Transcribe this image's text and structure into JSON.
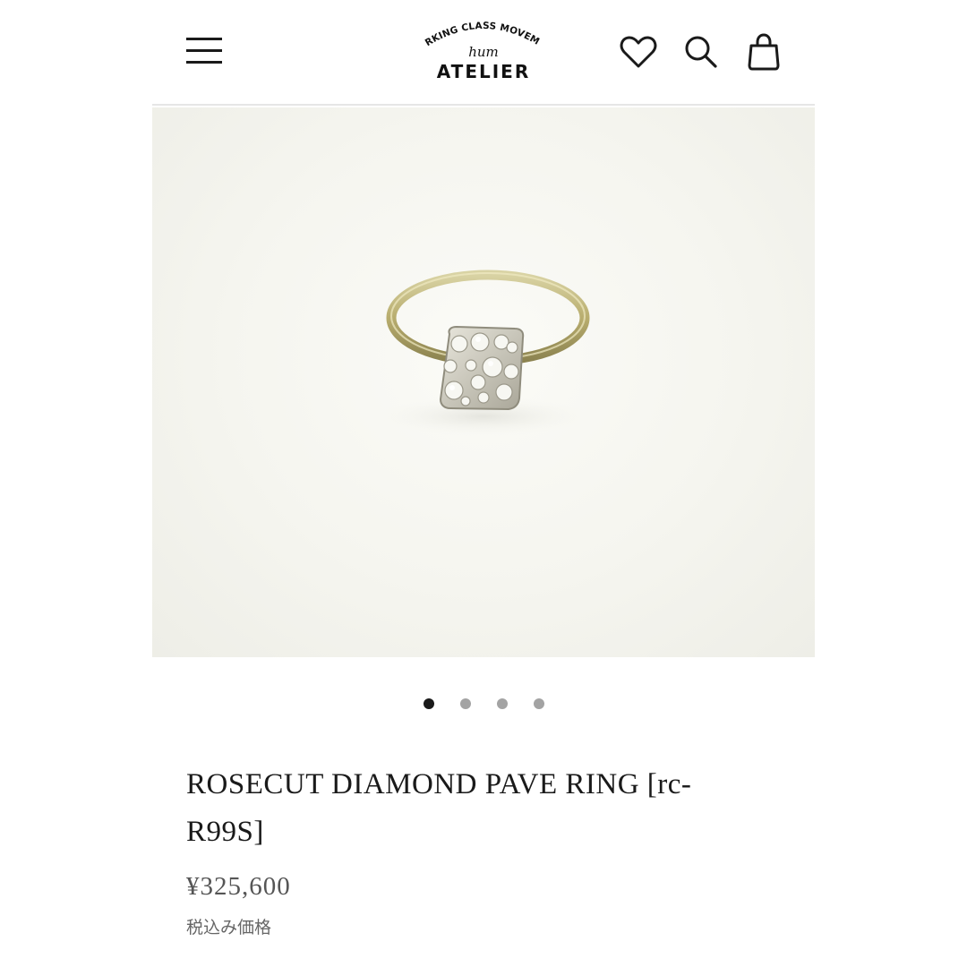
{
  "header": {
    "menu_icon": "hamburger-menu-icon",
    "logo": {
      "arc_text": "WORKING CLASS MOVEMENT",
      "script_text": "hum",
      "main_text": "ATELIER"
    },
    "icons": [
      "heart-icon",
      "search-icon",
      "shopping-bag-icon"
    ]
  },
  "gallery": {
    "slide_count": 4,
    "active_slide": 1,
    "image_subject": "ring-photo"
  },
  "product": {
    "title": "ROSECUT DIAMOND PAVE RING [rc-R99S]",
    "price": "¥325,600",
    "tax_note": "税込み価格"
  },
  "colors": {
    "text": "#1a1a1a",
    "muted": "#666666",
    "dot_inactive": "#a3a3a3",
    "dot_active": "#1a1a1a"
  }
}
